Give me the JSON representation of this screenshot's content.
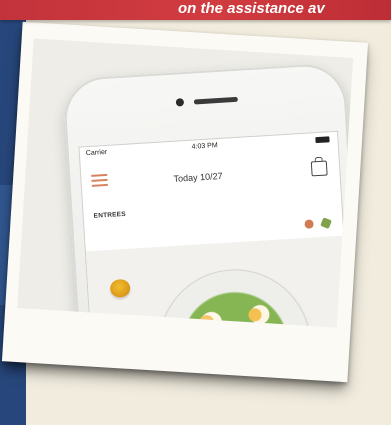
{
  "banner": {
    "text": "on the assistance av"
  },
  "phone": {
    "status": {
      "carrier": "Carrier",
      "time": "4:03 PM"
    },
    "header": {
      "date": "Today 10/27"
    },
    "section": "ENTREES"
  },
  "colors": {
    "banner_red": "#c3333b",
    "left_band_blue": "#27477c",
    "menu_accent": "#d9825f"
  },
  "icons": [
    "menu-icon",
    "shopping-bag-icon",
    "diet-icon",
    "fork-icon"
  ]
}
